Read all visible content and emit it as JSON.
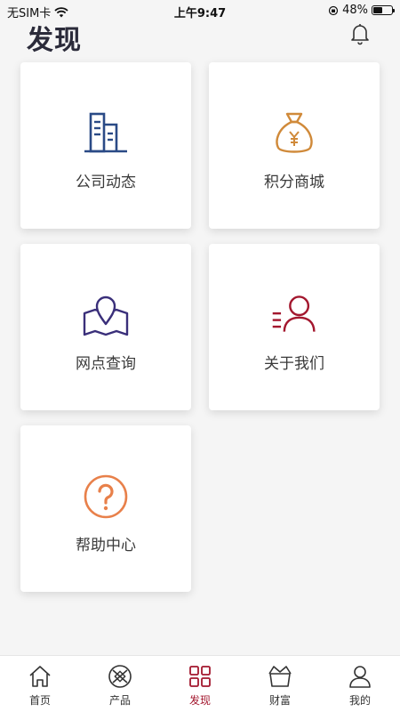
{
  "status_bar": {
    "carrier": "无SIM卡",
    "time": "上午9:47",
    "battery": "48%",
    "battery_level": 0.48
  },
  "header": {
    "title": "发现",
    "bell_icon": "bell-icon"
  },
  "cards": [
    {
      "label": "公司动态",
      "icon": "building-icon",
      "color": "#2a4a86"
    },
    {
      "label": "积分商城",
      "icon": "money-bag-icon",
      "color": "#d08a3a"
    },
    {
      "label": "网点查询",
      "icon": "map-pin-icon",
      "color": "#3a2f7a"
    },
    {
      "label": "关于我们",
      "icon": "person-icon",
      "color": "#a3172e"
    },
    {
      "label": "帮助中心",
      "icon": "question-icon",
      "color": "#e8804a"
    }
  ],
  "tabbar": {
    "active": "发现",
    "active_color": "#a3172e",
    "items": [
      {
        "label": "首页",
        "icon": "home-icon"
      },
      {
        "label": "产品",
        "icon": "product-icon"
      },
      {
        "label": "发现",
        "icon": "discover-icon"
      },
      {
        "label": "财富",
        "icon": "wealth-icon"
      },
      {
        "label": "我的",
        "icon": "profile-icon"
      }
    ]
  }
}
